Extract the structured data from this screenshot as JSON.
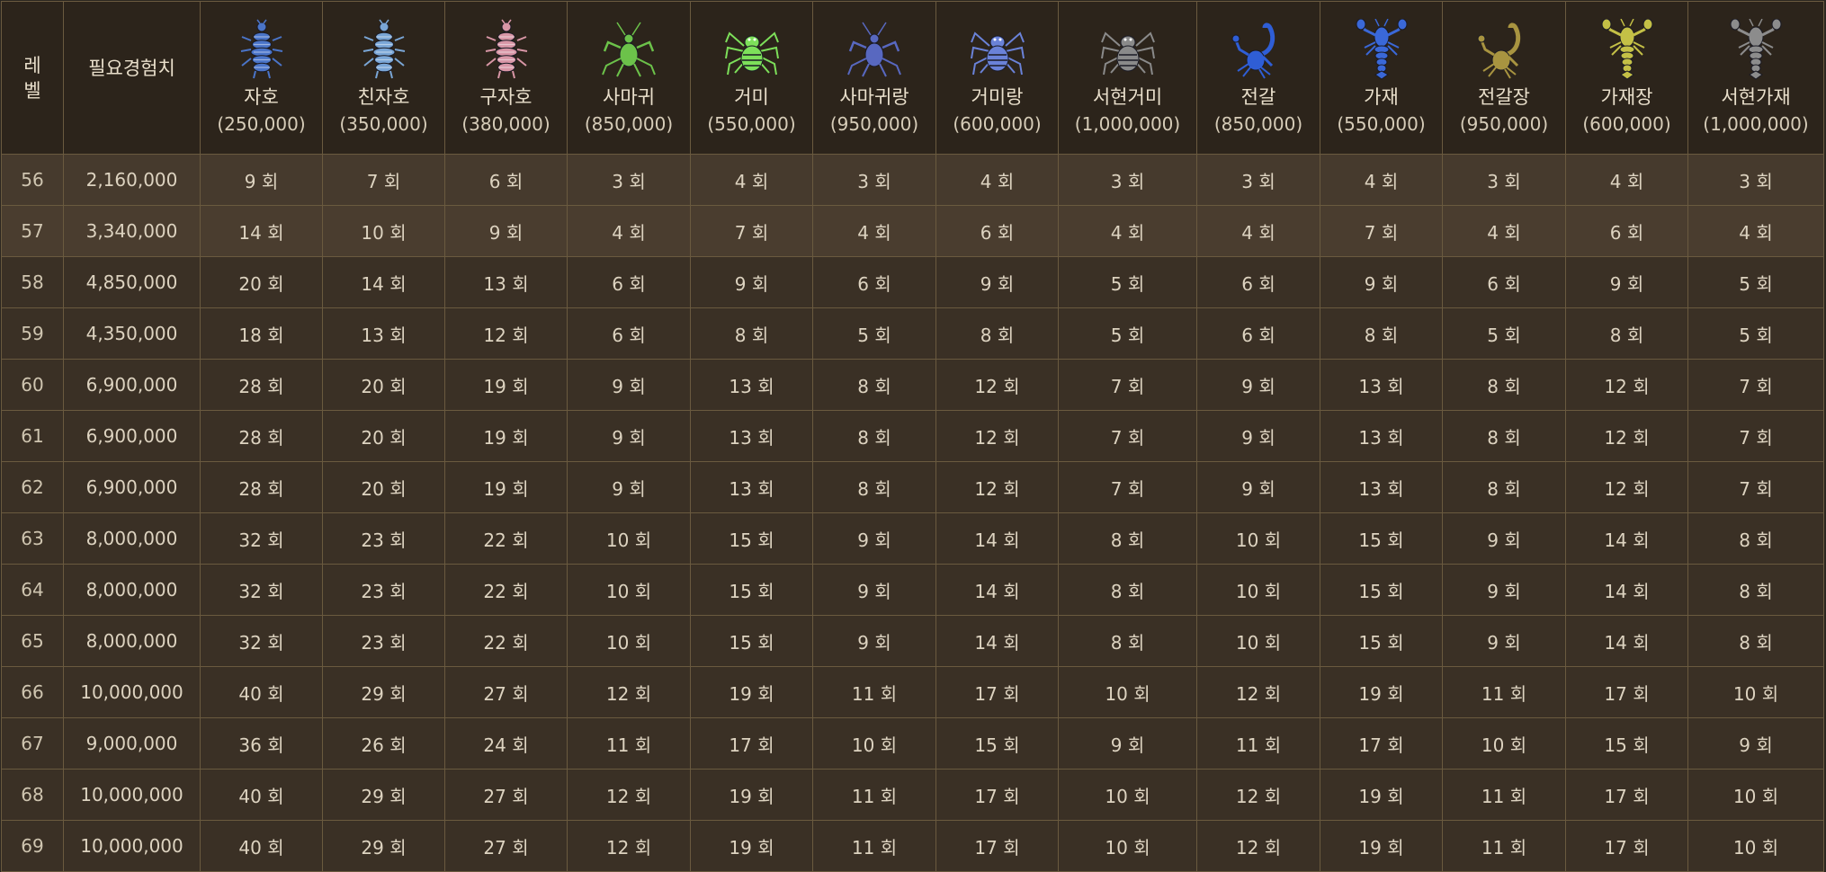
{
  "header": {
    "level_label": "레벨",
    "exp_label": "필요경험치"
  },
  "monsters": [
    {
      "name": "자호",
      "exp": "(250,000)",
      "icon": "blue-beetle-icon",
      "color": "#4a74c8"
    },
    {
      "name": "친자호",
      "exp": "(350,000)",
      "icon": "steel-beetle-icon",
      "color": "#7aa6d6"
    },
    {
      "name": "구자호",
      "exp": "(380,000)",
      "icon": "pink-beetle-icon",
      "color": "#d896a6"
    },
    {
      "name": "사마귀",
      "exp": "(850,000)",
      "icon": "green-mantis-icon",
      "color": "#6cc24a"
    },
    {
      "name": "거미",
      "exp": "(550,000)",
      "icon": "green-spider-icon",
      "color": "#7de05a"
    },
    {
      "name": "사마귀랑",
      "exp": "(950,000)",
      "icon": "blue-mantis-icon",
      "color": "#5868c0"
    },
    {
      "name": "거미랑",
      "exp": "(600,000)",
      "icon": "blue-spider-icon",
      "color": "#6a82d8"
    },
    {
      "name": "서현거미",
      "exp": "(1,000,000)",
      "icon": "gray-spider-icon",
      "color": "#8a8a8a"
    },
    {
      "name": "전갈",
      "exp": "(850,000)",
      "icon": "blue-scorpion-icon",
      "color": "#2f5ed6"
    },
    {
      "name": "가재",
      "exp": "(550,000)",
      "icon": "blue-crayfish-icon",
      "color": "#3a68d8"
    },
    {
      "name": "전갈장",
      "exp": "(950,000)",
      "icon": "gold-scorpion-icon",
      "color": "#a89440"
    },
    {
      "name": "가재장",
      "exp": "(600,000)",
      "icon": "yellow-crayfish-icon",
      "color": "#c4c046"
    },
    {
      "name": "서현가재",
      "exp": "(1,000,000)",
      "icon": "gray-crayfish-icon",
      "color": "#8c8c8c"
    }
  ],
  "rows": [
    {
      "level": "56",
      "exp": "2,160,000",
      "counts": [
        "9 회",
        "7 회",
        "6 회",
        "3 회",
        "4 회",
        "3 회",
        "4 회",
        "3 회",
        "3 회",
        "4 회",
        "3 회",
        "4 회",
        "3 회"
      ]
    },
    {
      "level": "57",
      "exp": "3,340,000",
      "counts": [
        "14 회",
        "10 회",
        "9 회",
        "4 회",
        "7 회",
        "4 회",
        "6 회",
        "4 회",
        "4 회",
        "7 회",
        "4 회",
        "6 회",
        "4 회"
      ]
    },
    {
      "level": "58",
      "exp": "4,850,000",
      "counts": [
        "20 회",
        "14 회",
        "13 회",
        "6 회",
        "9 회",
        "6 회",
        "9 회",
        "5 회",
        "6 회",
        "9 회",
        "6 회",
        "9 회",
        "5 회"
      ]
    },
    {
      "level": "59",
      "exp": "4,350,000",
      "counts": [
        "18 회",
        "13 회",
        "12 회",
        "6 회",
        "8 회",
        "5 회",
        "8 회",
        "5 회",
        "6 회",
        "8 회",
        "5 회",
        "8 회",
        "5 회"
      ]
    },
    {
      "level": "60",
      "exp": "6,900,000",
      "counts": [
        "28 회",
        "20 회",
        "19 회",
        "9 회",
        "13 회",
        "8 회",
        "12 회",
        "7 회",
        "9 회",
        "13 회",
        "8 회",
        "12 회",
        "7 회"
      ]
    },
    {
      "level": "61",
      "exp": "6,900,000",
      "counts": [
        "28 회",
        "20 회",
        "19 회",
        "9 회",
        "13 회",
        "8 회",
        "12 회",
        "7 회",
        "9 회",
        "13 회",
        "8 회",
        "12 회",
        "7 회"
      ]
    },
    {
      "level": "62",
      "exp": "6,900,000",
      "counts": [
        "28 회",
        "20 회",
        "19 회",
        "9 회",
        "13 회",
        "8 회",
        "12 회",
        "7 회",
        "9 회",
        "13 회",
        "8 회",
        "12 회",
        "7 회"
      ]
    },
    {
      "level": "63",
      "exp": "8,000,000",
      "counts": [
        "32 회",
        "23 회",
        "22 회",
        "10 회",
        "15 회",
        "9 회",
        "14 회",
        "8 회",
        "10 회",
        "15 회",
        "9 회",
        "14 회",
        "8 회"
      ]
    },
    {
      "level": "64",
      "exp": "8,000,000",
      "counts": [
        "32 회",
        "23 회",
        "22 회",
        "10 회",
        "15 회",
        "9 회",
        "14 회",
        "8 회",
        "10 회",
        "15 회",
        "9 회",
        "14 회",
        "8 회"
      ]
    },
    {
      "level": "65",
      "exp": "8,000,000",
      "counts": [
        "32 회",
        "23 회",
        "22 회",
        "10 회",
        "15 회",
        "9 회",
        "14 회",
        "8 회",
        "10 회",
        "15 회",
        "9 회",
        "14 회",
        "8 회"
      ]
    },
    {
      "level": "66",
      "exp": "10,000,000",
      "counts": [
        "40 회",
        "29 회",
        "27 회",
        "12 회",
        "19 회",
        "11 회",
        "17 회",
        "10 회",
        "12 회",
        "19 회",
        "11 회",
        "17 회",
        "10 회"
      ]
    },
    {
      "level": "67",
      "exp": "9,000,000",
      "counts": [
        "36 회",
        "26 회",
        "24 회",
        "11 회",
        "17 회",
        "10 회",
        "15 회",
        "9 회",
        "11 회",
        "17 회",
        "10 회",
        "15 회",
        "9 회"
      ]
    },
    {
      "level": "68",
      "exp": "10,000,000",
      "counts": [
        "40 회",
        "29 회",
        "27 회",
        "12 회",
        "19 회",
        "11 회",
        "17 회",
        "10 회",
        "12 회",
        "19 회",
        "11 회",
        "17 회",
        "10 회"
      ]
    },
    {
      "level": "69",
      "exp": "10,000,000",
      "counts": [
        "40 회",
        "29 회",
        "27 회",
        "12 회",
        "19 회",
        "11 회",
        "17 회",
        "10 회",
        "12 회",
        "19 회",
        "11 회",
        "17 회",
        "10 회"
      ]
    }
  ]
}
